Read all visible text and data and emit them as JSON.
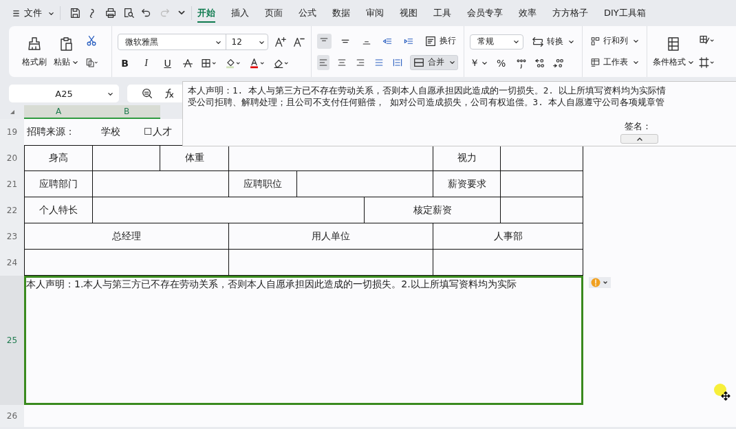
{
  "menu": {
    "label": "文件"
  },
  "quick_access": [
    {
      "disabled": false
    },
    {
      "disabled": false
    },
    {
      "disabled": false
    },
    {
      "disabled": false
    },
    {
      "disabled": false
    },
    {
      "disabled": true
    }
  ],
  "tabs": [
    {
      "label": "开始",
      "selected": true
    },
    {
      "label": "插入",
      "selected": false
    },
    {
      "label": "页面",
      "selected": false
    },
    {
      "label": "公式",
      "selected": false
    },
    {
      "label": "数据",
      "selected": false
    },
    {
      "label": "审阅",
      "selected": false
    },
    {
      "label": "视图",
      "selected": false
    },
    {
      "label": "工具",
      "selected": false
    },
    {
      "label": "会员专享",
      "selected": false
    },
    {
      "label": "效率",
      "selected": false
    },
    {
      "label": "方方格子",
      "selected": false
    },
    {
      "label": "DIY工具箱",
      "selected": false
    }
  ],
  "ribbon": {
    "format_painter": "格式刷",
    "paste": "粘贴",
    "font_family": "微软雅黑",
    "font_size": "12",
    "bold": "B",
    "italic": "I",
    "underline": "U",
    "align_top": [
      {
        "selected": true
      },
      {
        "selected": false
      },
      {
        "selected": false
      },
      {
        "selected": false
      },
      {
        "selected": false
      }
    ],
    "align_bottom": [
      {
        "selected": true
      },
      {
        "selected": false
      },
      {
        "selected": false
      },
      {
        "selected": false
      },
      {
        "selected": false
      }
    ],
    "wrap": "换行",
    "merge": {
      "label": "合并",
      "selected": true
    },
    "number_format": "常规",
    "convert": "转换",
    "currency": "￥",
    "percent": "%",
    "rows_cols": "行和列",
    "sheet": "工作表",
    "cond_format": "条件格式"
  },
  "formula_bar": {
    "cell": "A25",
    "popup_lines": [
      "本人声明：1. 本人与第三方已不存在劳动关系，否则本人自愿承担因此造成的一切损失。2. 以上所填写资料均为实际情",
      "受公司拒聘、解聘处理；且公司不支付任何赔偿， 如对公司造成损失，公司有权追偿。3. 本人自愿遵守公司各项规章管"
    ],
    "signature": "签名："
  },
  "columns": [
    {
      "label": "A",
      "selected": true
    },
    {
      "label": "B",
      "selected": true
    }
  ],
  "rows": [
    {
      "number": "19",
      "kind": "source",
      "selected": false,
      "items": [
        "招聘来源：",
        "学校",
        "☐人才"
      ]
    },
    {
      "number": "20",
      "kind": "table",
      "selected": false,
      "cells": [
        "身高",
        "体重",
        "视力"
      ]
    },
    {
      "number": "21",
      "kind": "table",
      "selected": false,
      "cells": [
        "应聘部门",
        "应聘职位",
        "薪资要求"
      ]
    },
    {
      "number": "22",
      "kind": "table",
      "selected": false,
      "cells": [
        "个人特长",
        "核定薪资"
      ]
    },
    {
      "number": "23",
      "kind": "table",
      "selected": false,
      "cells": [
        "总经理",
        "用人单位",
        "人事部"
      ]
    },
    {
      "number": "24",
      "kind": "table",
      "selected": false
    },
    {
      "number": "25",
      "kind": "note",
      "selected": true,
      "text": "本人声明：1.本人与第三方已不存在劳动关系，否则本人自愿承担因此造成的一切损失。2.以上所填写资料均为实际"
    },
    {
      "number": "26",
      "kind": "blank",
      "selected": false
    }
  ]
}
